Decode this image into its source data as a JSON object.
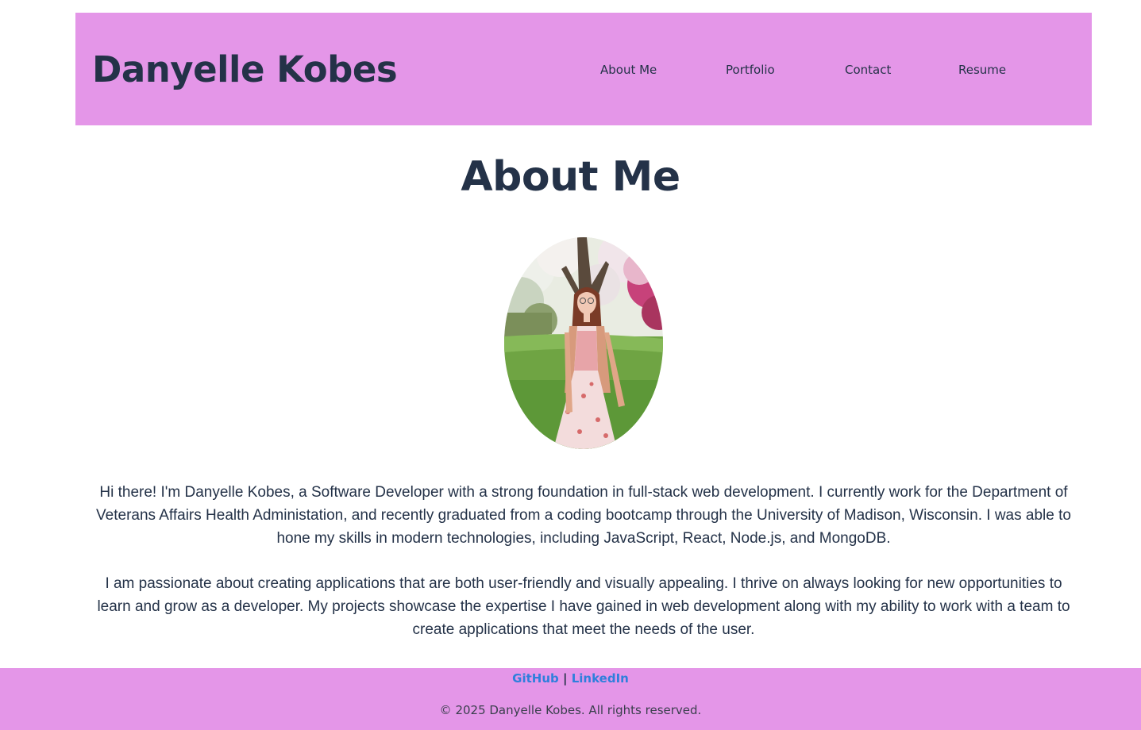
{
  "header": {
    "site_title": "Danyelle Kobes",
    "nav": [
      "About Me",
      "Portfolio",
      "Contact",
      "Resume"
    ]
  },
  "main": {
    "section_title": "About Me",
    "portrait": {
      "icon": "profile-photo"
    },
    "paragraphs": [
      "Hi there! I'm Danyelle Kobes, a Software Developer with a strong foundation in full-stack web development. I currently work for the Department of Veterans Affairs Health Administation, and recently graduated from a coding bootcamp through the University of Madison, Wisconsin. I was able to hone my skills in modern technologies, including JavaScript, React, Node.js, and MongoDB.",
      "I am passionate about creating applications that are both user-friendly and visually appealing. I thrive on always looking for new opportunities to learn and grow as a developer. My projects showcase the expertise I have gained in web development along with my ability to work with a team to create applications that meet the needs of the user."
    ]
  },
  "footer": {
    "links": [
      "GitHub",
      "LinkedIn"
    ],
    "separator": "|",
    "copyright": "© 2025 Danyelle Kobes. All rights reserved."
  },
  "colors": {
    "header_bg": "#e496e8",
    "footer_bg": "#e496e8",
    "heading_text": "#243248",
    "link": "#2f7fdc"
  }
}
